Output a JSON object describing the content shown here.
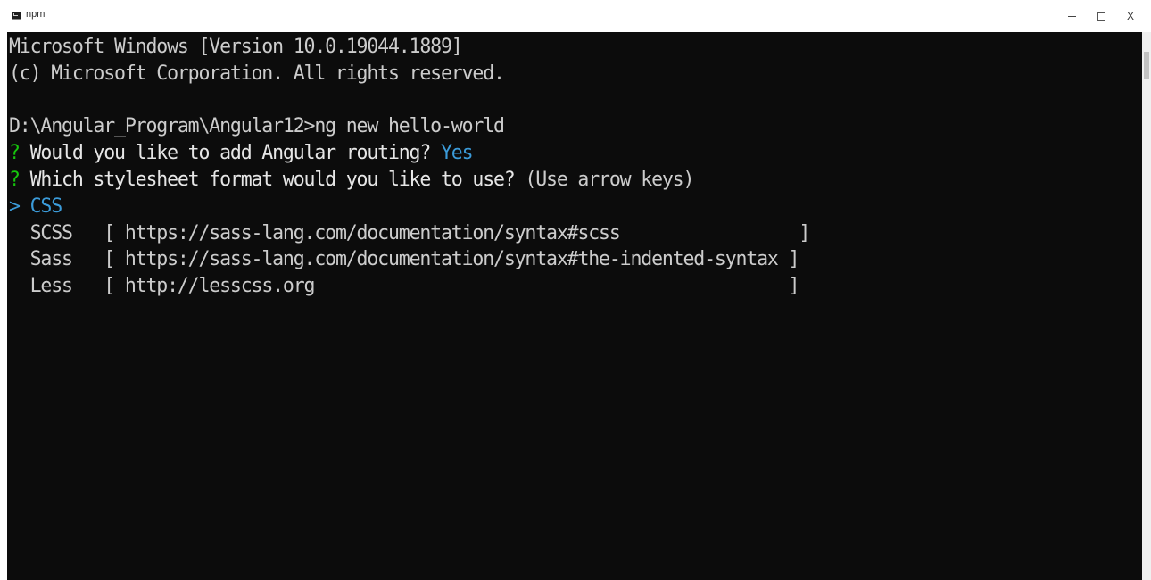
{
  "window": {
    "title": "npm",
    "controls": {
      "minimize": "minimize",
      "maximize": "maximize",
      "close": "X"
    }
  },
  "console": {
    "banner_line1": "Microsoft Windows [Version 10.0.19044.1889]",
    "banner_line2": "(c) Microsoft Corporation. All rights reserved.",
    "prompt_path": "D:\\Angular_Program\\Angular12>",
    "command": "ng new hello-world",
    "q1_mark": "?",
    "q1_text": " Would you like to add Angular routing? ",
    "q1_answer": "Yes",
    "q2_mark": "?",
    "q2_text": " Which stylesheet format would you like to use? ",
    "q2_hint": "(Use arrow keys)",
    "options": [
      {
        "marker": "> ",
        "name": "CSS",
        "link": ""
      },
      {
        "marker": "  ",
        "name": "SCSS   ",
        "link": "[ https://sass-lang.com/documentation/syntax#scss                 ]"
      },
      {
        "marker": "  ",
        "name": "Sass   ",
        "link": "[ https://sass-lang.com/documentation/syntax#the-indented-syntax ]"
      },
      {
        "marker": "  ",
        "name": "Less   ",
        "link": "[ http://lesscss.org                                             ]"
      }
    ]
  },
  "colors": {
    "background": "#0c0c0c",
    "text": "#cccccc",
    "question_mark": "#16c60c",
    "answer": "#3b9bd9"
  }
}
